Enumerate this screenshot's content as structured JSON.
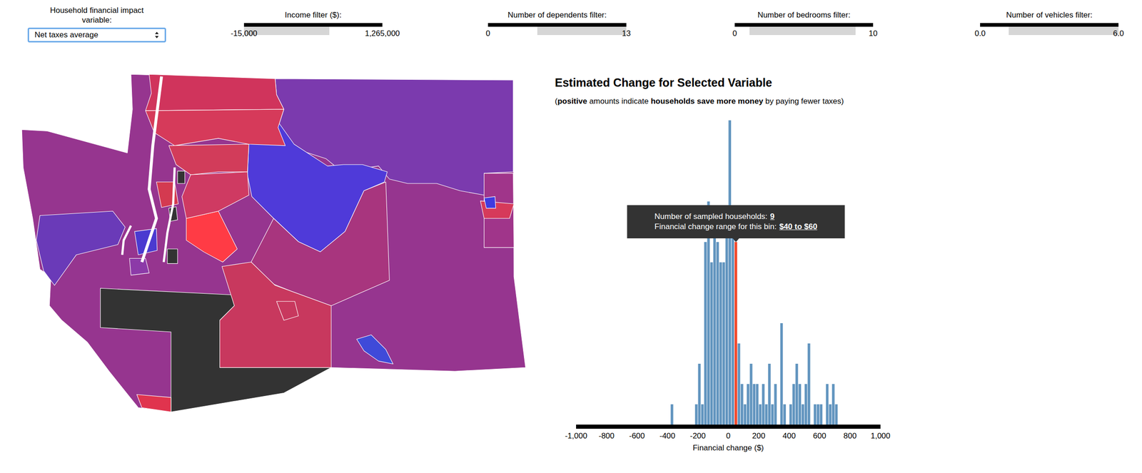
{
  "controls": {
    "variable": {
      "label": "Household financial impact variable:",
      "value": "Net taxes average",
      "focused": true
    }
  },
  "filters": [
    {
      "label": "Income filter ($):",
      "min": "-15,000",
      "max": "1,265,000",
      "low": 0,
      "high": 0.616
    },
    {
      "label": "Number of dependents filter:",
      "min": "0",
      "max": "13",
      "low": 0.358,
      "high": 1
    },
    {
      "label": "Number of bedrooms filter:",
      "min": "0",
      "max": "10",
      "low": 0.105,
      "high": 0.874
    },
    {
      "label": "Number of vehicles filter:",
      "min": "0.0",
      "max": "6.0",
      "low": 0.205,
      "high": 1
    }
  ],
  "map": {
    "districts": [
      {
        "color": "#96358f"
      },
      {
        "color": "#7b3aae"
      },
      {
        "color": "#4f3ad9"
      },
      {
        "color": "#a8357e"
      },
      {
        "color": "#6a3ab8"
      },
      {
        "color": "#333333"
      },
      {
        "color": "#c8385e"
      },
      {
        "color": "#d0345c"
      },
      {
        "color": "#d63a5a"
      },
      {
        "color": "#d23c5a"
      },
      {
        "color": "#ff3b45"
      },
      {
        "color": "#cf3a62"
      },
      {
        "color": "#4a3ad0"
      },
      {
        "color": "#d43a50"
      },
      {
        "color": "#333333"
      },
      {
        "color": "#333333"
      },
      {
        "color": "#333333"
      },
      {
        "color": "#8c3aa8"
      },
      {
        "color": "#a0358a"
      },
      {
        "color": "#d63a5a"
      },
      {
        "color": "#3f3ae0"
      },
      {
        "color": "#3f4ad9"
      },
      {
        "color": "#c8385e"
      },
      {
        "color": "#e0344e"
      }
    ]
  },
  "chart": {
    "title": "Estimated Change for Selected Variable",
    "subtitle": [
      {
        "text": "(",
        "bold": false
      },
      {
        "text": "positive",
        "bold": true
      },
      {
        "text": " amounts indicate ",
        "bold": false
      },
      {
        "text": "households save more money",
        "bold": true
      },
      {
        "text": " by paying fewer taxes)",
        "bold": false
      }
    ],
    "x_ticks": [
      "-1,000",
      "-800",
      "-600",
      "-400",
      "-200",
      "0",
      "200",
      "400",
      "600",
      "800",
      "1,000"
    ],
    "x_label": "Financial change ($)",
    "bin_start": -1000,
    "bin_width": 20,
    "counts": [
      0,
      0,
      0,
      0,
      0,
      0,
      0,
      0,
      0,
      0,
      0,
      0,
      0,
      0,
      0,
      0,
      0,
      0,
      0,
      0,
      0,
      0,
      0,
      0,
      0,
      0,
      0,
      0,
      0,
      0,
      0,
      1,
      0,
      0,
      0,
      0,
      0,
      0,
      0,
      1,
      3,
      1,
      9,
      11,
      8,
      10,
      9,
      8,
      8,
      10,
      15,
      10,
      9,
      4,
      2,
      1,
      2,
      3,
      2,
      2,
      1,
      2,
      1,
      3,
      1,
      2,
      0,
      5,
      1,
      0,
      1,
      2,
      3,
      2,
      1,
      2,
      4,
      0,
      1,
      1,
      1,
      0,
      2,
      1,
      2,
      1,
      0,
      0,
      0,
      0,
      0,
      0,
      0,
      0,
      0,
      0,
      0,
      0,
      0,
      0
    ],
    "selected_bin": 52,
    "tooltip": {
      "count_label": "Number of sampled households:",
      "count": "9",
      "range_label": "Financial change range for this bin:",
      "range": "$40 to $60"
    }
  }
}
